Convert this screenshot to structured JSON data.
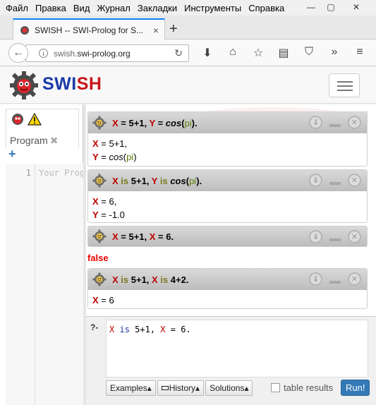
{
  "menubar": {
    "items": [
      "Файл",
      "Правка",
      "Вид",
      "Журнал",
      "Закладки",
      "Инструменты",
      "Справка"
    ]
  },
  "window_controls": {
    "minimize": "—",
    "maximize": "▢",
    "close": "✕"
  },
  "browser": {
    "tab_title": "SWISH -- SWI-Prolog for S...",
    "tab_close": "×",
    "new_tab": "+",
    "url_prefix": "swish.",
    "url_domain": "swi-prolog.org",
    "icons": [
      "download-icon",
      "home-icon",
      "star-icon",
      "reader-icon",
      "pocket-icon",
      "overflow-icon",
      "menu-icon"
    ]
  },
  "swish": {
    "brand_sw": "SWI",
    "brand_sh": "SH"
  },
  "editor": {
    "tab_label": "Program",
    "tab_close": "✖",
    "add": "+",
    "line_number": "1",
    "placeholder": "Your Program"
  },
  "answers": [
    {
      "query": [
        {
          "t": "X",
          "c": "v"
        },
        {
          "t": " = 5+1, ",
          "c": ""
        },
        {
          "t": "Y",
          "c": "v"
        },
        {
          "t": " = ",
          "c": ""
        },
        {
          "t": "cos",
          "c": "fn"
        },
        {
          "t": "(",
          "c": ""
        },
        {
          "t": "pi",
          "c": "at"
        },
        {
          "t": ").",
          "c": ""
        }
      ],
      "lines": [
        [
          {
            "t": "X",
            "c": "v"
          },
          {
            "t": " = 5+1,",
            "c": ""
          }
        ],
        [
          {
            "t": "Y",
            "c": "v"
          },
          {
            "t": " = ",
            "c": ""
          },
          {
            "t": "cos",
            "c": "fn"
          },
          {
            "t": "(",
            "c": ""
          },
          {
            "t": "pi",
            "c": "at"
          },
          {
            "t": ")",
            "c": ""
          }
        ]
      ]
    },
    {
      "query": [
        {
          "t": "X",
          "c": "v"
        },
        {
          "t": " is ",
          "c": "k"
        },
        {
          "t": "5+1, ",
          "c": ""
        },
        {
          "t": "Y",
          "c": "v"
        },
        {
          "t": " is ",
          "c": "k"
        },
        {
          "t": "cos",
          "c": "fn"
        },
        {
          "t": "(",
          "c": ""
        },
        {
          "t": "pi",
          "c": "at"
        },
        {
          "t": ").",
          "c": ""
        }
      ],
      "lines": [
        [
          {
            "t": "X",
            "c": "v"
          },
          {
            "t": " = 6,",
            "c": ""
          }
        ],
        [
          {
            "t": "Y",
            "c": "v"
          },
          {
            "t": " = -1.0",
            "c": ""
          }
        ]
      ]
    },
    {
      "query": [
        {
          "t": "X",
          "c": "v"
        },
        {
          "t": " = 5+1, ",
          "c": ""
        },
        {
          "t": "X",
          "c": "v"
        },
        {
          "t": " = 6.",
          "c": ""
        }
      ],
      "false_text": "false"
    },
    {
      "query": [
        {
          "t": "X",
          "c": "v"
        },
        {
          "t": " is ",
          "c": "k"
        },
        {
          "t": "5+1, ",
          "c": ""
        },
        {
          "t": "X",
          "c": "v"
        },
        {
          "t": " is ",
          "c": "k"
        },
        {
          "t": "4+2.",
          "c": ""
        }
      ],
      "lines": [
        [
          {
            "t": "X",
            "c": "v"
          },
          {
            "t": " = 6",
            "c": ""
          }
        ]
      ]
    }
  ],
  "answer_controls": {
    "next": "⇓",
    "close": "✕"
  },
  "query_panel": {
    "prompt": "?-",
    "input": [
      {
        "t": "X",
        "c": "v"
      },
      {
        "t": " ",
        "c": ""
      },
      {
        "t": "is",
        "c": "k"
      },
      {
        "t": " 5+1, ",
        "c": ""
      },
      {
        "t": "X",
        "c": "v"
      },
      {
        "t": " = 6.",
        "c": ""
      }
    ],
    "examples_label": "Examples▴",
    "history_label": "History▴",
    "solutions_label": "Solutions▴",
    "table_results_label": "table results",
    "run_label": "Run!"
  }
}
